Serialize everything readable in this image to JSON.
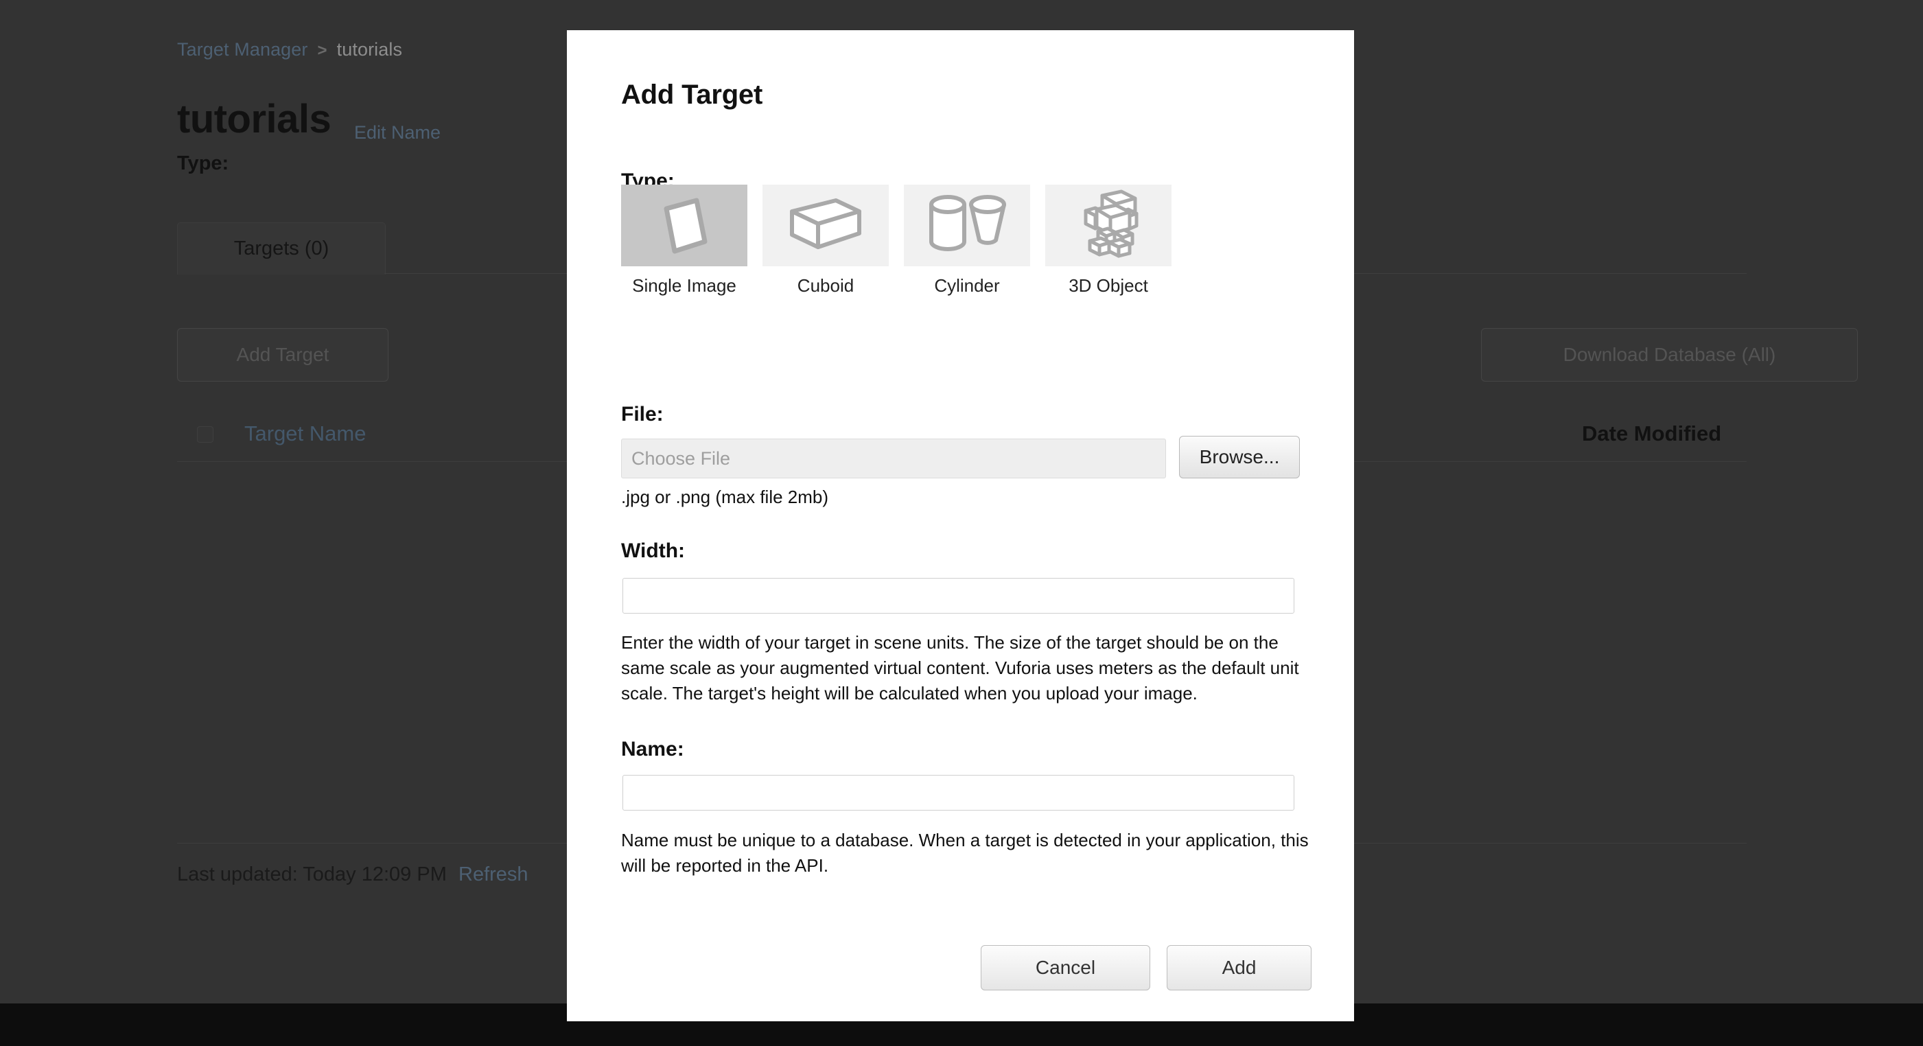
{
  "background": {
    "breadcrumb": {
      "root": "Target Manager",
      "separator": ">",
      "current": "tutorials"
    },
    "page_title": "tutorials",
    "edit_name_link": "Edit Name",
    "type_label": "Type:",
    "tab_targets": "Targets (0)",
    "add_target_button": "Add Target",
    "download_database_button": "Download Database (All)",
    "table_headers": {
      "target_name": "Target Name",
      "date_modified": "Date Modified"
    },
    "last_updated": "Last updated: Today 12:09 PM",
    "refresh_link": "Refresh"
  },
  "modal": {
    "title": "Add Target",
    "type": {
      "label": "Type:",
      "selected": "Single Image",
      "options": [
        {
          "label": "Single Image",
          "icon": "single-image-icon",
          "selected": true
        },
        {
          "label": "Cuboid",
          "icon": "cuboid-icon",
          "selected": false
        },
        {
          "label": "Cylinder",
          "icon": "cylinder-icon",
          "selected": false
        },
        {
          "label": "3D Object",
          "icon": "3d-object-icon",
          "selected": false
        }
      ]
    },
    "file": {
      "label": "File:",
      "value": "",
      "placeholder": "Choose File",
      "browse_button": "Browse...",
      "help": ".jpg or .png (max file 2mb)"
    },
    "width": {
      "label": "Width:",
      "value": "",
      "help": "Enter the width of your target in scene units. The size of the target should be on the same scale as your augmented virtual content. Vuforia uses meters as the default unit scale. The target's height will be calculated when you upload your image."
    },
    "name": {
      "label": "Name:",
      "value": "",
      "help": "Name must be unique to a database. When a target is detected in your application, this will be reported in the API."
    },
    "actions": {
      "cancel": "Cancel",
      "add": "Add"
    }
  },
  "colors": {
    "overlay_dim": "#333333",
    "footer_band": "#0d0d0d",
    "modal_bg": "#ffffff",
    "link": "#4d6073",
    "tile_bg": "#f1f1f1",
    "tile_selected_bg": "#c6c6c6",
    "icon_stroke": "#a9a9a9"
  }
}
